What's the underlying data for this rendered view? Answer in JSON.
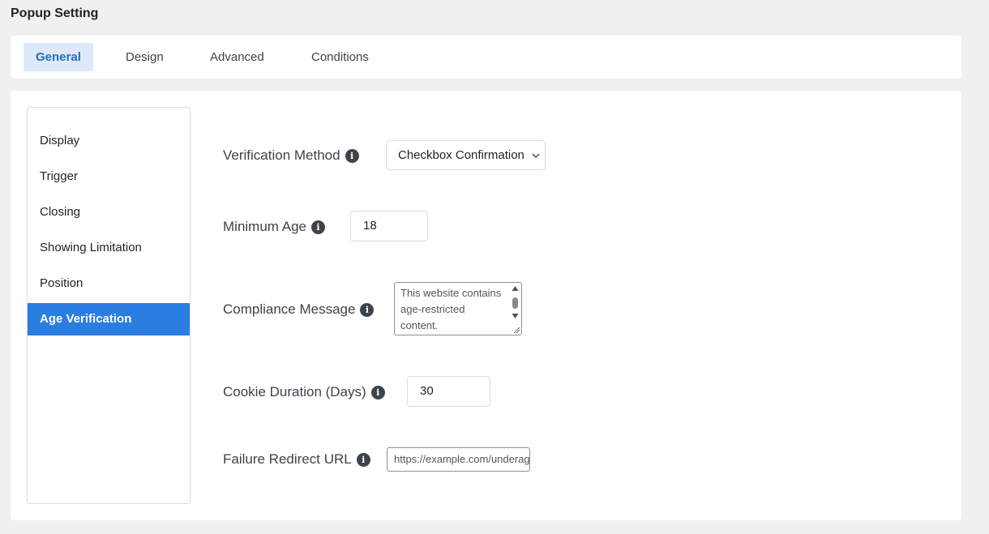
{
  "page_title": "Popup Setting",
  "tabs": [
    {
      "label": "General",
      "active": true
    },
    {
      "label": "Design",
      "active": false
    },
    {
      "label": "Advanced",
      "active": false
    },
    {
      "label": "Conditions",
      "active": false
    }
  ],
  "sidebar": {
    "items": [
      {
        "label": "Display"
      },
      {
        "label": "Trigger"
      },
      {
        "label": "Closing"
      },
      {
        "label": "Showing Limitation"
      },
      {
        "label": "Position"
      },
      {
        "label": "Age Verification",
        "active": true
      }
    ]
  },
  "fields": {
    "verification_method": {
      "label": "Verification Method",
      "value": "Checkbox Confirmation"
    },
    "minimum_age": {
      "label": "Minimum Age",
      "value": "18"
    },
    "compliance_message": {
      "label": "Compliance Message",
      "value": "This website contains age-restricted content."
    },
    "cookie_duration": {
      "label": "Cookie Duration (Days)",
      "value": "30"
    },
    "failure_redirect": {
      "label": "Failure Redirect URL",
      "value": "https://example.com/underage"
    }
  },
  "icons": {
    "info": "info-icon",
    "dropdown": "chevron-down-icon"
  },
  "colors": {
    "accent": "#2a7de1",
    "tab_active_bg": "#dde9f9",
    "tab_active_text": "#2271b1",
    "page_bg": "#f0f0f1"
  }
}
